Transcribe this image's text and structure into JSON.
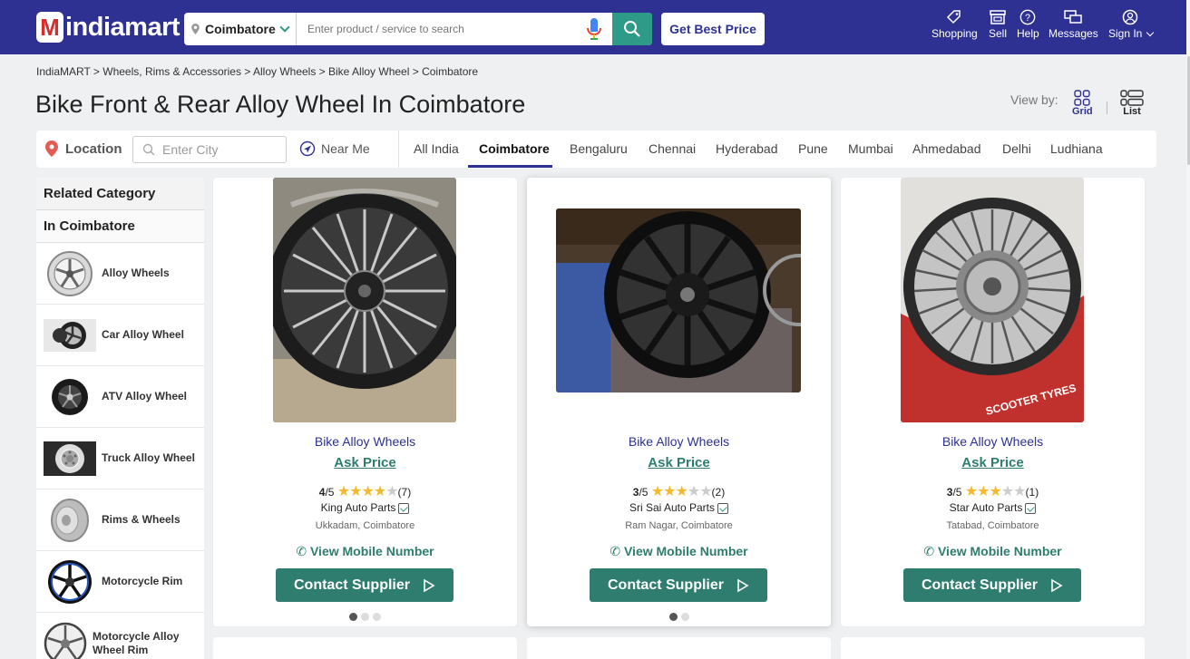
{
  "header": {
    "logo_text": "indiamart",
    "city": "Coimbatore",
    "search_placeholder": "Enter product / service to search",
    "best_price": "Get Best Price",
    "nav": [
      {
        "label": "Shopping",
        "icon": "tag-icon"
      },
      {
        "label": "Sell",
        "icon": "store-icon"
      },
      {
        "label": "Help",
        "icon": "help-icon"
      },
      {
        "label": "Messages",
        "icon": "messages-icon"
      },
      {
        "label": "Sign In",
        "icon": "user-icon"
      }
    ],
    "colors": {
      "brand": "#2e3192",
      "accent": "#2e9a88",
      "logo_red": "#d32f2f"
    }
  },
  "breadcrumb": "IndiaMART > Wheels, Rims & Accessories > Alloy Wheels > Bike Alloy Wheel > Coimbatore",
  "page_title": "Bike Front & Rear Alloy Wheel In Coimbatore",
  "view_by": {
    "label": "View by:",
    "grid": "Grid",
    "list": "List"
  },
  "location_bar": {
    "label": "Location",
    "city_placeholder": "Enter City",
    "near_me": "Near Me",
    "cities": [
      "All India",
      "Coimbatore",
      "Bengaluru",
      "Chennai",
      "Hyderabad",
      "Pune",
      "Mumbai",
      "Ahmedabad",
      "Delhi",
      "Ludhiana"
    ],
    "active_city": "Coimbatore"
  },
  "sidebar": {
    "heading": "Related Category",
    "subheading": "In Coimbatore",
    "items": [
      {
        "label": "Alloy Wheels"
      },
      {
        "label": "Car Alloy Wheel"
      },
      {
        "label": "ATV Alloy Wheel"
      },
      {
        "label": "Truck Alloy Wheel"
      },
      {
        "label": "Rims & Wheels"
      },
      {
        "label": "Motorcycle Rim"
      },
      {
        "label": "Motorcycle Alloy Wheel Rim"
      }
    ]
  },
  "products": [
    {
      "title": "Bike Alloy Wheels",
      "price": "Ask Price",
      "rating": "4",
      "rating_suffix": "/5",
      "reviews": "(7)",
      "stars": 4,
      "supplier": "King Auto Parts",
      "location": "Ukkadam, Coimbatore",
      "mobile": "View Mobile Number",
      "contact": "Contact Supplier",
      "image_dots": 3
    },
    {
      "title": "Bike Alloy Wheels",
      "price": "Ask Price",
      "rating": "3",
      "rating_suffix": "/5",
      "reviews": "(2)",
      "stars": 3,
      "supplier": "Sri Sai Auto Parts",
      "location": "Ram Nagar, Coimbatore",
      "mobile": "View Mobile Number",
      "contact": "Contact Supplier",
      "image_dots": 2
    },
    {
      "title": "Bike Alloy Wheels",
      "price": "Ask Price",
      "rating": "3",
      "rating_suffix": "/5",
      "reviews": "(1)",
      "stars": 3,
      "supplier": "Star Auto Parts",
      "location": "Tatabad, Coimbatore",
      "mobile": "View Mobile Number",
      "contact": "Contact Supplier",
      "image_dots": 0,
      "image_banner": "SCOOTER TYRES"
    }
  ]
}
